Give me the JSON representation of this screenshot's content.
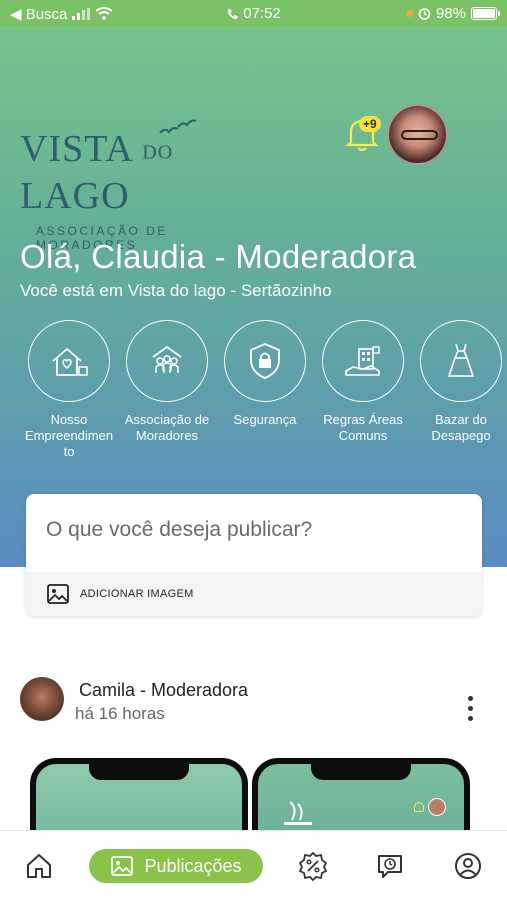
{
  "status_bar": {
    "back_label": "◀ Busca",
    "time": "07:52",
    "battery": "98%"
  },
  "header": {
    "logo_title_1": "VISTA",
    "logo_title_small": "DO",
    "logo_title_2": "LAGO",
    "logo_subtitle": "ASSOCIAÇÃO DE MORADORES",
    "notification_badge": "+9"
  },
  "greeting": {
    "title": "Olá, Claudia - Moderadora",
    "location": "Você está em Vista do lago - Sertãozinho"
  },
  "shortcuts": [
    {
      "label": "Nosso Empreendimen to",
      "icon": "house-heart-icon"
    },
    {
      "label": "Associação de Moradores",
      "icon": "people-group-icon"
    },
    {
      "label": "Segurança",
      "icon": "shield-lock-icon"
    },
    {
      "label": "Regras Áreas Comuns",
      "icon": "hand-building-icon"
    },
    {
      "label": "Bazar do Desapego",
      "icon": "dress-icon"
    }
  ],
  "composer": {
    "prompt": "O que você deseja publicar?",
    "add_image": "ADICIONAR IMAGEM"
  },
  "post": {
    "author": "Camila - Moderadora",
    "time": "há 16 horas"
  },
  "bottom_nav": {
    "active_label": "Publicações"
  },
  "colors": {
    "status_bar": "#7bc267",
    "nav_pill": "#8bc34a",
    "gradient_top": "#79c38c",
    "gradient_bottom": "#5b8cc4"
  }
}
